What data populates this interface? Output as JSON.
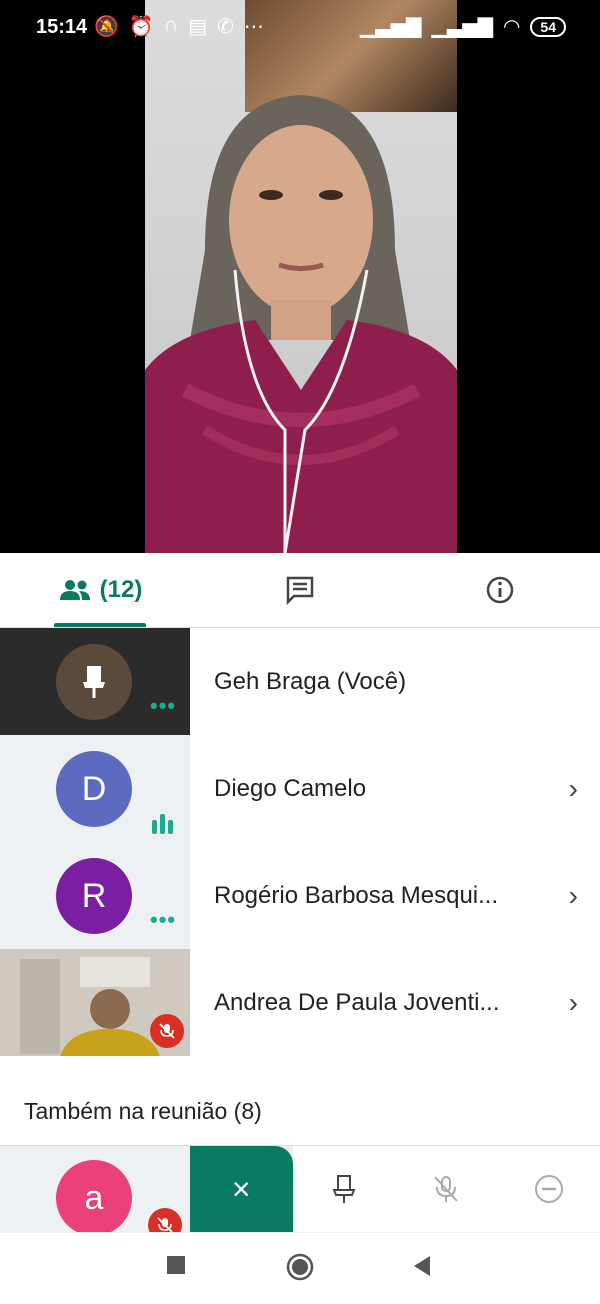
{
  "status_bar": {
    "time": "15:14",
    "battery": "54"
  },
  "tabs": {
    "people_count": "(12)"
  },
  "participants": [
    {
      "name": "Geh Braga (Você)",
      "initial": "",
      "color": "#2b2b2b"
    },
    {
      "name": "Diego Camelo",
      "initial": "D",
      "color": "#5c6bc0"
    },
    {
      "name": "Rogério Barbosa Mesqui...",
      "initial": "R",
      "color": "#7b1fa2"
    },
    {
      "name": "Andrea De Paula Joventi...",
      "initial": "",
      "color": "#c9b18a"
    }
  ],
  "also_in_meeting": {
    "title": "Também na reunião (8)"
  },
  "bottom_participant": {
    "initial": "a",
    "color": "#ec407a"
  },
  "colors": {
    "accent": "#0b7a63",
    "speaking": "#1fa88b",
    "muted": "#d93025"
  }
}
